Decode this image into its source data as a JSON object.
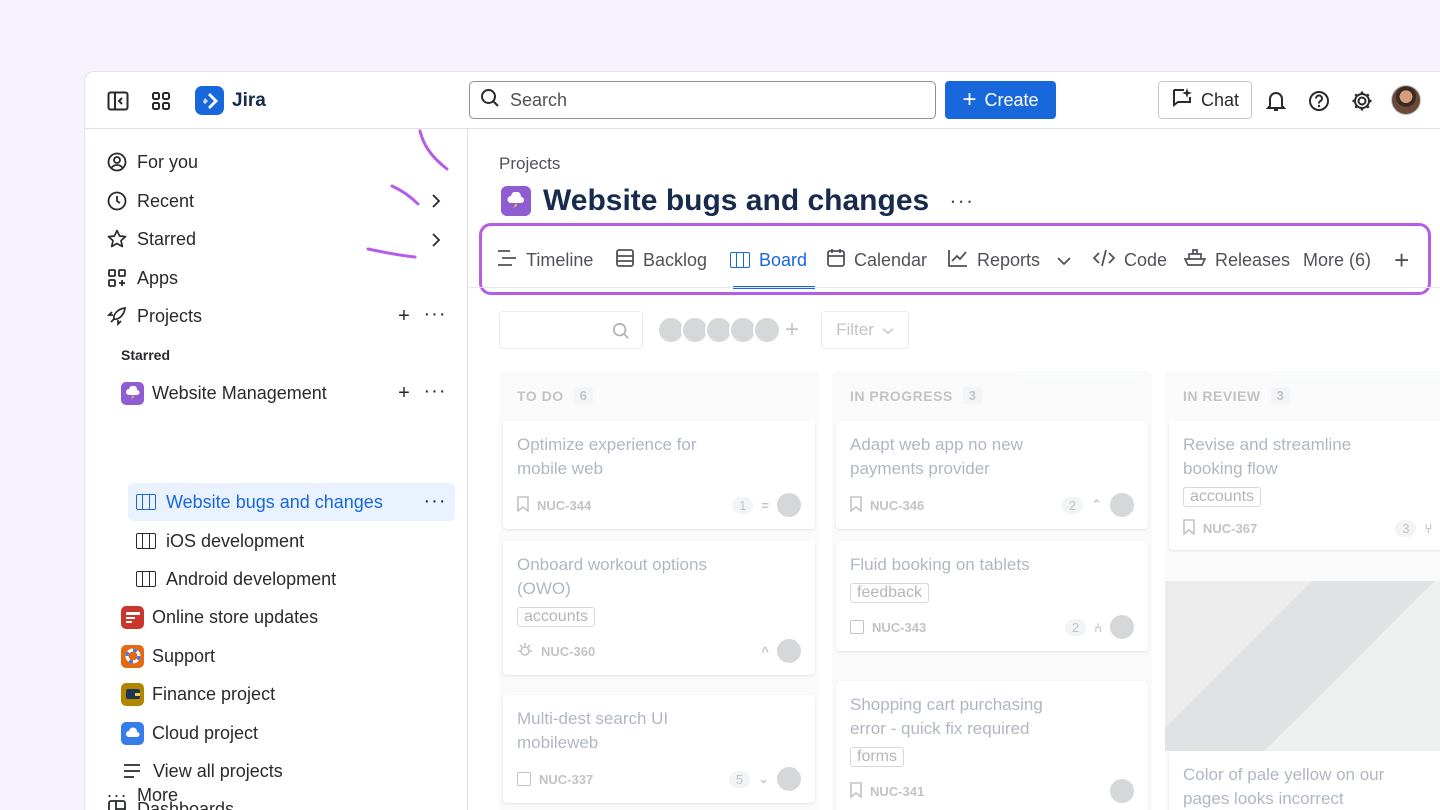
{
  "topbar": {
    "app_name": "Jira",
    "search_placeholder": "Search",
    "create_label": "Create",
    "chat_label": "Chat",
    "icons": [
      "sidebar-toggle-icon",
      "app-switcher-icon",
      "jira-logo",
      "search-icon",
      "plus-icon",
      "chat-sparkle-icon",
      "bell-icon",
      "help-icon",
      "settings-icon"
    ],
    "accent": "#1868db"
  },
  "sidebar": {
    "nav": [
      {
        "label": "For you",
        "icon": "user-circle-icon"
      },
      {
        "label": "Recent",
        "icon": "clock-icon"
      },
      {
        "label": "Starred",
        "icon": "star-icon"
      },
      {
        "label": "Apps",
        "icon": "apps-icon"
      },
      {
        "label": "Projects",
        "icon": "rocket-icon"
      }
    ],
    "starred_label": "Starred",
    "projects": [
      {
        "label": "Website Management",
        "color": "#8f5cd1"
      },
      {
        "label": "Online store updates",
        "color": "#c9372c"
      },
      {
        "label": "Support",
        "color": "#e56910"
      },
      {
        "label": "Finance project",
        "color": "#b38600"
      },
      {
        "label": "Cloud project",
        "color": "#357de8"
      }
    ],
    "sub_items": [
      "Website bugs and changes",
      "iOS development",
      "Android development"
    ],
    "view_all": "View all projects",
    "dashboards": "Dashboards",
    "more": "More"
  },
  "main": {
    "breadcrumb": "Projects",
    "title": "Website bugs and changes",
    "tabs": [
      "Timeline",
      "Backlog",
      "Board",
      "Calendar",
      "Reports",
      "Code",
      "Releases",
      "More (6)"
    ],
    "active_tab": "Board",
    "highlight_color": "#b65de8"
  },
  "board": {
    "filter_label": "Filter",
    "columns": [
      {
        "name": "TO DO",
        "count": "6",
        "cards": [
          {
            "title": "Optimize experience for mobile web",
            "key": "NUC-344",
            "estimate": "1",
            "label": ""
          },
          {
            "title": "Onboard workout options (OWO)",
            "key": "NUC-360",
            "estimate": "",
            "label": "accounts"
          },
          {
            "title": "Multi-dest search UI mobileweb",
            "key": "NUC-337",
            "estimate": "5",
            "label": ""
          }
        ]
      },
      {
        "name": "IN PROGRESS",
        "count": "3",
        "cards": [
          {
            "title": "Adapt web app no new payments provider",
            "key": "NUC-346",
            "estimate": "2",
            "label": ""
          },
          {
            "title": "Fluid booking on tablets",
            "key": "NUC-343",
            "estimate": "2",
            "label": "feedback"
          },
          {
            "title": "Shopping cart purchasing error - quick fix required",
            "key": "NUC-341",
            "estimate": "",
            "label": "forms"
          }
        ]
      },
      {
        "name": "IN REVIEW",
        "count": "3",
        "cards": [
          {
            "title": "Revise and streamline booking flow",
            "key": "NUC-367",
            "estimate": "3",
            "label": "accounts"
          },
          {
            "title": "Color of pale yellow on our pages looks incorrect",
            "key": "",
            "estimate": "",
            "label": ""
          }
        ]
      }
    ]
  }
}
